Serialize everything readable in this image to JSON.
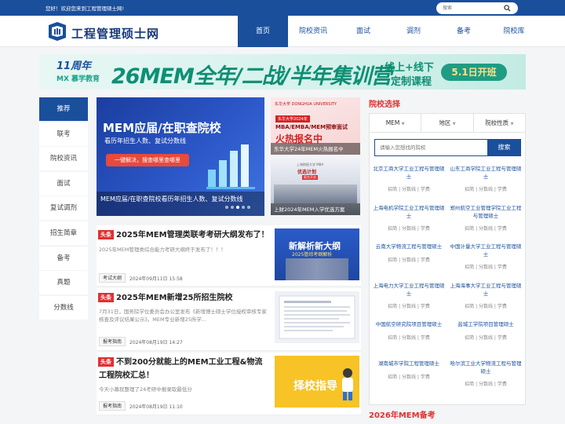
{
  "topbar": {
    "welcome": "您好！欢迎您来到工程管理硕士网!",
    "search_placeholder": "搜索"
  },
  "brand": {
    "name": "工程管理硕士网"
  },
  "nav": {
    "items": [
      "首页",
      "院校资讯",
      "面试",
      "调剂",
      "备考",
      "院校库"
    ],
    "active": 0
  },
  "banner": {
    "logo_line1": "11周年",
    "logo_line2": "MX 慕学教育",
    "title": "26MEM全年/二战/半年集训营",
    "sub1": "线上+线下",
    "sub2": "定制课程",
    "button": "5.1日开班"
  },
  "sidenav": [
    "推荐",
    "联考",
    "院校资讯",
    "面试",
    "复试调剂",
    "招生简章",
    "备考",
    "真题",
    "分数线"
  ],
  "hero": {
    "title": "MEM应届/在职查院校",
    "subtitle": "看历年招生人数、复试分数线",
    "button": "一键解决，搜查哪里查哪里",
    "caption": "MEM应届/在职查院校看历年招生人数、复试分数线"
  },
  "side1": {
    "top": "东华大学 DONGHUA UNIVERSITY",
    "tag": "东华大学2024年",
    "line1": "MBA/EMBA/MEM预审面试",
    "line2": "火热报名中",
    "caption": "东华大学24年MEM火热报名中"
  },
  "side2": {
    "top": "上海财经大学 MBA",
    "title": "优选计划",
    "badge": "报名开启",
    "caption": "上财2024年MEM入学优选方案"
  },
  "news": [
    {
      "tag": "头条",
      "title": "2025年MEM管理类联考考研大纲发布了！",
      "excerpt": "2025年MEM管理类综合能力考研大纲终于发布了！！！",
      "category": "考试大纲",
      "date": "2024年09月11日 15:58",
      "thumb_text1": "新解析新大纲",
      "thumb_text2": "2025管综考纲解析"
    },
    {
      "tag": "头条",
      "title": "2025年MEM新增25所招生院校",
      "excerpt": "7月31日，国务院学位委员会办公室发布《新增博士硕士学位授权审核专家核查及评议结果公示》。MEM专业新增25所学...",
      "category": "报考指南",
      "date": "2024年08月19日 14:27"
    },
    {
      "tag": "头条",
      "title": "不到200分就能上的MEM工业工程&物流工程院校汇总！",
      "excerpt": "今天小慕就整理了24考研中报录取最低分",
      "category": "报考指南",
      "date": "2024年08月19日 11:10",
      "thumb_text": "择校指导"
    }
  ],
  "schools": {
    "heading": "院校选择",
    "filters": [
      "MEM",
      "地区",
      "院校性质"
    ],
    "search_placeholder": "请输入您想找的院校",
    "search_button": "搜索",
    "links_label": "招简 | 分数线 | 学费",
    "items": [
      "北京工商大学工业工程与管理硕士",
      "山东工商学院工业工程与管理硕士",
      "上海电机学院工业工程与管理硕士",
      "郑州航空工业管理学院工业工程与管理硕士",
      "云南大学物流工程与管理硕士",
      "中国计量大学工业工程与管理硕士",
      "上海电力大学工业工程与管理硕士",
      "上海海事大学工业工程与管理硕士",
      "中国航空研究院项目管理硕士",
      "盐城工学院项目管理硕士",
      "湖南城市学院工程管理硕士",
      "哈尔滨工业大学物流工程与管理硕士"
    ]
  },
  "bottom": {
    "heading": "2026年MEM备考"
  }
}
